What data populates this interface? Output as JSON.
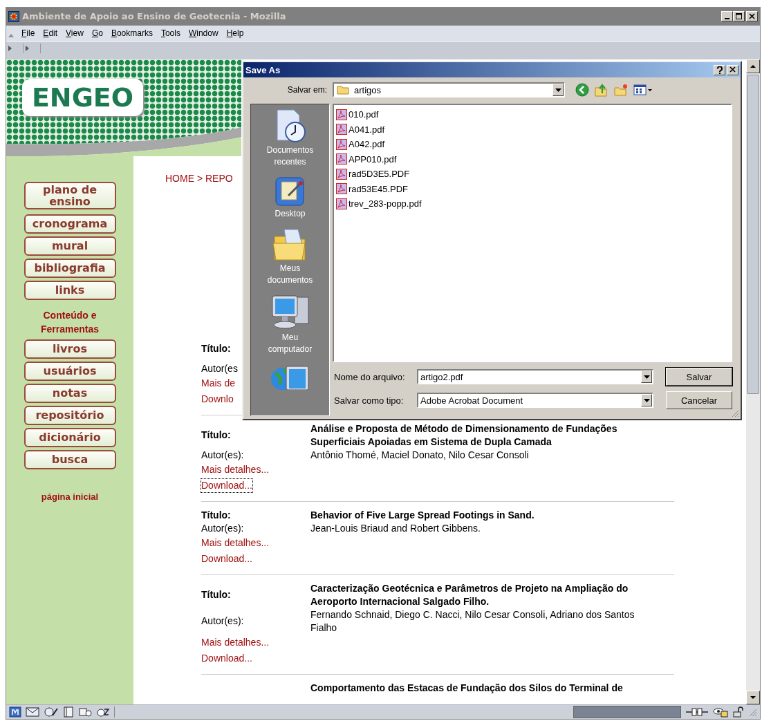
{
  "window": {
    "title": "Ambiente de Apoio ao Ensino de Geotecnia - Mozilla"
  },
  "menu": [
    "File",
    "Edit",
    "View",
    "Go",
    "Bookmarks",
    "Tools",
    "Window",
    "Help"
  ],
  "logo": "ENGEO",
  "sidebar": {
    "nav_buttons": [
      "plano de ensino",
      "cronograma",
      "mural",
      "bibliografia",
      "links"
    ],
    "section_title": "Conteúdo e Ferramentas",
    "tool_buttons": [
      "livros",
      "usuários",
      "notas",
      "repositório",
      "dicionário",
      "busca"
    ],
    "home_link": "página inicial"
  },
  "breadcrumb": "HOME > REPO",
  "entries": [
    {
      "title_label": "Título:",
      "authors_label": "Autor(es",
      "details_link": "Mais de",
      "download_link": "Downlo",
      "focused": false
    },
    {
      "title_label": "Título:",
      "title": "Análise e Proposta de Método de Dimensionamento de Fundações Superficiais Apoiadas em Sistema de Dupla Camada",
      "authors_label": "Autor(es):",
      "authors": "Antônio Thomé, Maciel Donato, Nilo Cesar Consoli",
      "details_link": "Mais detalhes...",
      "download_link": "Download...",
      "focused": true
    },
    {
      "title_label": "Título:",
      "title": "Behavior of Five Large Spread Footings in Sand.",
      "authors_label": "Autor(es):",
      "authors": "Jean-Louis Briaud and Robert Gibbens.",
      "details_link": "Mais detalhes...",
      "download_link": "Download...",
      "focused": false
    },
    {
      "title_label": "Título:",
      "title": "Caracterização Geotécnica e Parâmetros de Projeto na Ampliação do Aeroporto Internacional Salgado Filho.",
      "authors_label": "Autor(es):",
      "authors": "Fernando Schnaid, Diego C. Nacci, Nilo Cesar Consoli, Adriano dos Santos Fialho",
      "details_link": "Mais detalhes...",
      "download_link": "Download...",
      "focused": false
    },
    {
      "title": "Comportamento das Estacas de Fundação dos Silos do Terminal de"
    }
  ],
  "dialog": {
    "title": "Save As",
    "look_in_label": "Salvar em:",
    "folder": "artigos",
    "places": [
      {
        "kind": "recent",
        "label": "Documentos recentes"
      },
      {
        "kind": "desktop",
        "label": "Desktop"
      },
      {
        "kind": "documents",
        "label": "Meus documentos"
      },
      {
        "kind": "computer",
        "label": "Meu computador"
      },
      {
        "kind": "network"
      }
    ],
    "files": [
      "010.pdf",
      "A041.pdf",
      "A042.pdf",
      "APP010.pdf",
      "rad5D3E5.PDF",
      "rad53E45.PDF",
      "trev_283-popp.pdf"
    ],
    "file_name_label": "Nome do arquivo:",
    "file_name": "artigo2.pdf",
    "type_label": "Salvar como tipo:",
    "type": "Adobe Acrobat Document",
    "buttons": [
      {
        "label": "Salvar",
        "default": true
      },
      {
        "label": "Cancelar",
        "default": false
      }
    ]
  }
}
